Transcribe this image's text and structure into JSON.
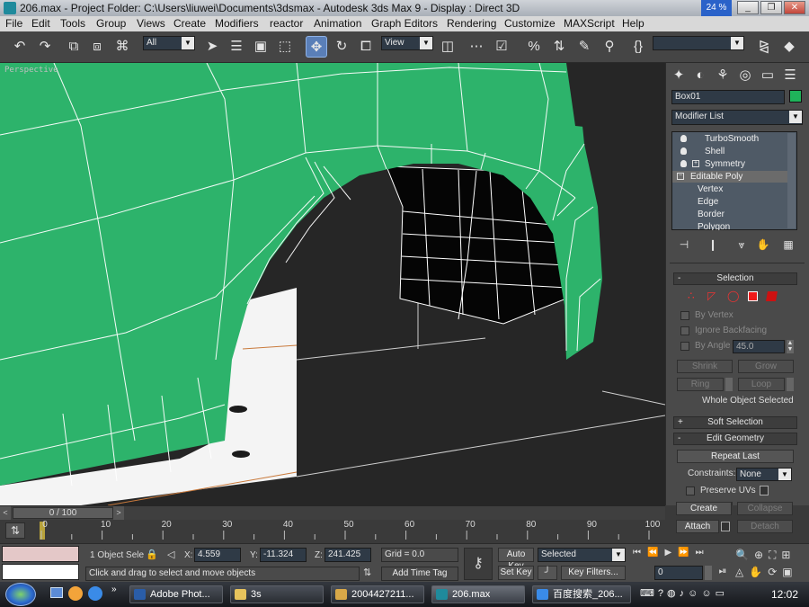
{
  "window": {
    "title": "206.max    - Project Folder: C:\\Users\\liuwei\\Documents\\3dsmax     - Autodesk 3ds Max 9      - Display : Direct 3D",
    "cpu_badge": "24 %",
    "minimize": "_",
    "restore": "❐",
    "close": "✕"
  },
  "menu": [
    "File",
    "Edit",
    "Tools",
    "Group",
    "Views",
    "Create",
    "Modifiers",
    "reactor",
    "Animation",
    "Graph Editors",
    "Rendering",
    "Customize",
    "MAXScript",
    "Help"
  ],
  "toolbar": {
    "selection_filter": "All",
    "ref_coord": "View",
    "named_selection": ""
  },
  "viewport": {
    "label": "Perspective",
    "colors": {
      "object": "#2db36b",
      "wire": "#ffffff",
      "background": "#262626"
    }
  },
  "command_panel": {
    "object_name": "Box01",
    "object_color": "#1fb35a",
    "modifier_list": "Modifier List",
    "stack": [
      "TurboSmooth",
      "Shell",
      "Symmetry",
      "Editable Poly",
      "Vertex",
      "Edge",
      "Border",
      "Polygon"
    ],
    "selection_rollout": "Selection",
    "by_vertex": "By Vertex",
    "ignore_backfacing": "Ignore Backfacing",
    "by_angle": "By Angle",
    "angle_value": "45.0",
    "shrink": "Shrink",
    "grow": "Grow",
    "ring": "Ring",
    "loop": "Loop",
    "selection_info": "Whole Object Selected",
    "soft_selection": "Soft Selection",
    "edit_geometry": "Edit Geometry",
    "repeat_last": "Repeat Last",
    "constraints": "Constraints:",
    "constraints_value": "None",
    "preserve_uvs": "Preserve UVs",
    "create": "Create",
    "collapse": "Collapse",
    "attach": "Attach",
    "detach": "Detach"
  },
  "timeline": {
    "frame": "0 / 100",
    "ticks": [
      "0",
      "10",
      "20",
      "30",
      "40",
      "50",
      "60",
      "70",
      "80",
      "90",
      "100"
    ]
  },
  "status": {
    "selection": "1 Object Sele",
    "x_label": "X:",
    "x": "4.559",
    "y_label": "Y:",
    "y": "-11.324",
    "z_label": "Z:",
    "z": "241.425",
    "grid": "Grid = 0.0",
    "prompt": "Click and drag to select and move objects",
    "add_time_tag": "Add Time Tag",
    "auto_key": "Auto Key",
    "set_key": "Set Key",
    "key_mode": "Selected",
    "key_filters": "Key Filters...",
    "current_frame": "0"
  },
  "taskbar": {
    "items": [
      "Adobe Phot...",
      "3s",
      "2004427211...",
      "206.max",
      "百度搜索_206..."
    ],
    "clock": "12:02"
  }
}
